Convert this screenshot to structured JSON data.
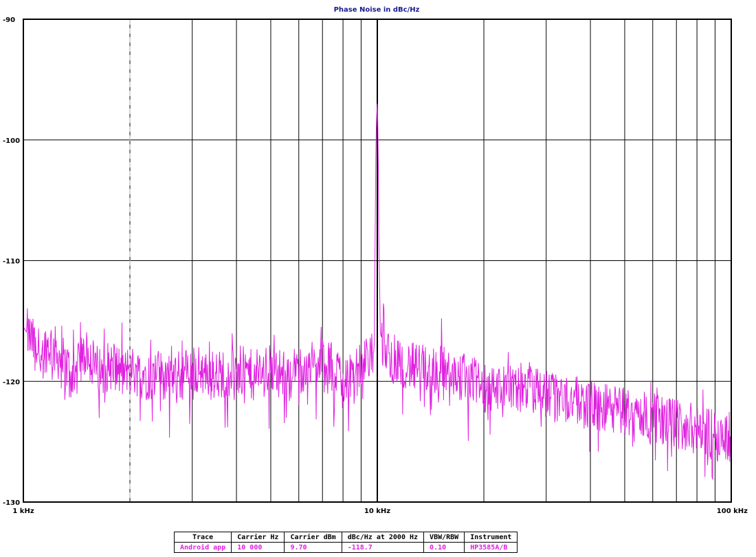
{
  "chart_data": {
    "type": "line",
    "title": "Phase Noise in dBc/Hz",
    "xscale": "log",
    "xlim": [
      1000,
      100000
    ],
    "ylim": [
      -130,
      -90
    ],
    "yticks": [
      -90,
      -100,
      -110,
      -120,
      -130
    ],
    "ytick_labels": [
      "-90",
      "-100",
      "-110",
      "-120",
      "-130"
    ],
    "xticks": [
      1000,
      10000,
      100000
    ],
    "xtick_labels": [
      "1 kHz",
      "10 kHz",
      "100 kHz"
    ],
    "grid": true,
    "reference_line_x": 2000,
    "colors": {
      "trace": "#e020e0",
      "grid": "#000000",
      "reference": "#c0c0c0",
      "title": "#1a1a8c"
    },
    "series": [
      {
        "name": "Android app",
        "x": [
          1000,
          1050,
          1100,
          1200,
          1300,
          1400,
          1500,
          1600,
          1700,
          1800,
          1900,
          2000,
          2200,
          2500,
          2800,
          3000,
          3500,
          4000,
          4500,
          5000,
          5500,
          6000,
          7000,
          8000,
          9000,
          9500,
          9800,
          9900,
          9950,
          10000,
          10050,
          10100,
          10200,
          10500,
          11000,
          12000,
          13000,
          15000,
          17000,
          20000,
          25000,
          30000,
          35000,
          40000,
          50000,
          60000,
          70000,
          80000,
          90000,
          100000
        ],
        "values": [
          -115.5,
          -116.5,
          -117.5,
          -117,
          -118.5,
          -119.5,
          -117.5,
          -119,
          -119,
          -118.5,
          -119.5,
          -119,
          -119.5,
          -119.5,
          -119.5,
          -119,
          -119.5,
          -119,
          -119.5,
          -119,
          -119.5,
          -119,
          -118.5,
          -119.5,
          -119,
          -118,
          -117.5,
          -101.5,
          -98,
          -97,
          -99.5,
          -108,
          -116,
          -117.5,
          -118,
          -118.5,
          -119,
          -119,
          -119.5,
          -120.5,
          -120.5,
          -121,
          -121.5,
          -122,
          -122.5,
          -123,
          -123.5,
          -124,
          -124.5,
          -124.5
        ]
      }
    ],
    "table": {
      "headers": [
        "Trace",
        "Carrier Hz",
        "Carrier dBm",
        "dBc/Hz at 2000 Hz",
        "VBW/RBW",
        "Instrument"
      ],
      "rows": [
        [
          "Android app",
          "10 000",
          "9.70",
          "-118.7",
          "0.10",
          "HP3585A/B"
        ]
      ]
    }
  }
}
